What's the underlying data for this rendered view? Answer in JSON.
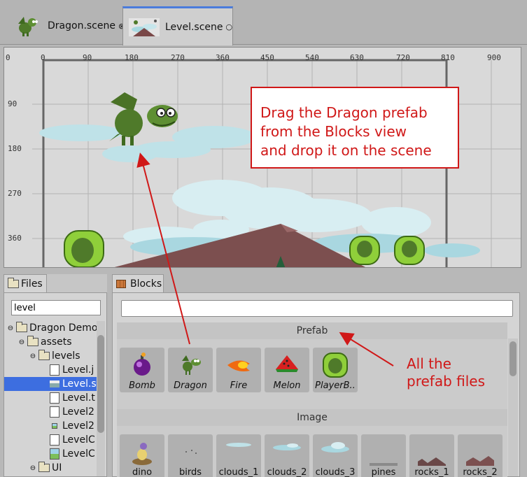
{
  "tabs": [
    {
      "label": "Dragon.scene",
      "close": "⊗",
      "active": false
    },
    {
      "label": "Level.scene",
      "close": "○",
      "active": true
    }
  ],
  "scene": {
    "ruler_x": [
      "0",
      "0",
      "90",
      "180",
      "270",
      "360",
      "450",
      "540",
      "630",
      "720",
      "810",
      "900"
    ],
    "ruler_y": [
      "90",
      "180",
      "270",
      "360"
    ],
    "callout": "Drag the Dragon prefab\nfrom the Blocks view\nand drop it on the scene"
  },
  "files": {
    "tab_label": "Files",
    "search_value": "level",
    "tree": [
      {
        "label": "Dragon Demo",
        "expander": "⊖"
      },
      {
        "label": "assets",
        "expander": "⊖"
      },
      {
        "label": "levels",
        "expander": "⊖"
      },
      {
        "label": "Level.j",
        "expander": ""
      },
      {
        "label": "Level.s",
        "expander": ""
      },
      {
        "label": "Level.t",
        "expander": ""
      },
      {
        "label": "Level2",
        "expander": ""
      },
      {
        "label": "Level2",
        "expander": ""
      },
      {
        "label": "LevelC",
        "expander": ""
      },
      {
        "label": "LevelC",
        "expander": ""
      },
      {
        "label": "UI",
        "expander": "⊖"
      }
    ]
  },
  "blocks": {
    "tab_label": "Blocks",
    "filter_value": "",
    "sections": [
      {
        "title": "Prefab",
        "items": [
          "Bomb",
          "Dragon",
          "Fire",
          "Melon",
          "PlayerB.."
        ]
      },
      {
        "title": "Image",
        "items": [
          "dino",
          "birds",
          "clouds_1",
          "clouds_2",
          "clouds_3",
          "pines",
          "rocks_1",
          "rocks_2"
        ]
      }
    ]
  },
  "annotation": "All the\nprefab files",
  "colors": {
    "accent": "#d01818",
    "selection": "#3d6ee0",
    "active_tab": "#4a7bdc"
  }
}
